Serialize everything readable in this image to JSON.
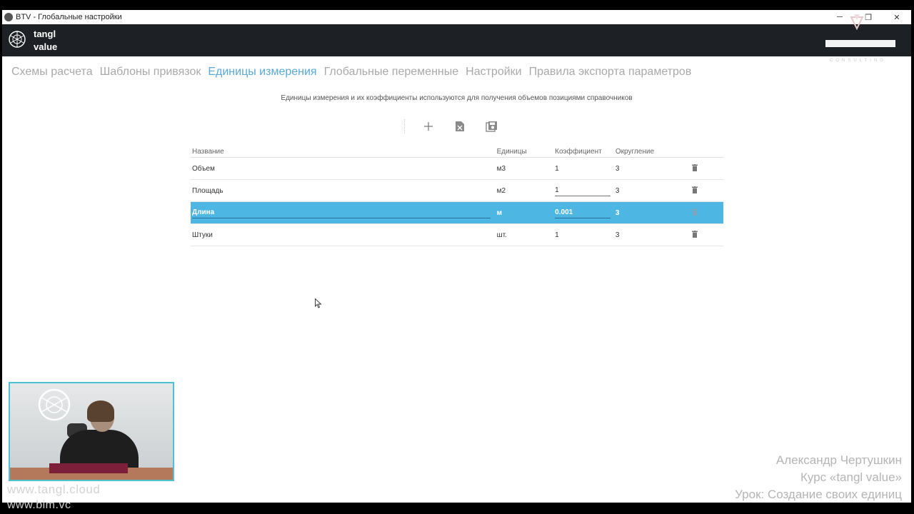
{
  "window": {
    "title": "BTV - Глобальные настройки"
  },
  "window_controls": {
    "minimize": "─",
    "restore": "❐",
    "close": "✕"
  },
  "app_header": {
    "logo_line1": "tangl",
    "logo_line2": "value"
  },
  "brand_watermark": {
    "text": "CONSULTING"
  },
  "nav": {
    "tabs": [
      {
        "label": "Схемы расчета"
      },
      {
        "label": "Шаблоны привязок"
      },
      {
        "label": "Единицы измерения"
      },
      {
        "label": "Глобальные переменные"
      },
      {
        "label": "Настройки"
      },
      {
        "label": "Правила экспорта параметров"
      }
    ],
    "active_index": 2
  },
  "description": "Единицы измерения и их коэффициенты используются для получения объемов позициями справочников",
  "toolbar": {
    "add_icon": "plus-icon",
    "excel_icon": "excel-icon",
    "save_icon": "save-icon"
  },
  "table": {
    "headers": {
      "name": "Название",
      "unit": "Единицы",
      "coef": "Коэффициент",
      "round": "Округление"
    },
    "rows": [
      {
        "name": "Объем",
        "unit": "м3",
        "coef": "1",
        "round": "3"
      },
      {
        "name": "Площадь",
        "unit": "м2",
        "coef": "1",
        "round": "3"
      },
      {
        "name": "Длина",
        "unit": "м",
        "coef": "0.001",
        "round": "3"
      },
      {
        "name": "Штуки",
        "unit": "шт.",
        "coef": "1",
        "round": "3"
      }
    ],
    "selected_index": 2
  },
  "watermarks": {
    "site1": "www.tangl.cloud",
    "site2": "www.bim.vc"
  },
  "credits": {
    "line1": "Александр Чертушкин",
    "line2": "Курс «tangl value»",
    "line3": "Урок: Создание своих единиц"
  },
  "colors": {
    "accent": "#5aa9d6",
    "selected_row": "#4db6e3",
    "header_bg": "#1d2125",
    "webcam_border": "#4cc3d3"
  }
}
